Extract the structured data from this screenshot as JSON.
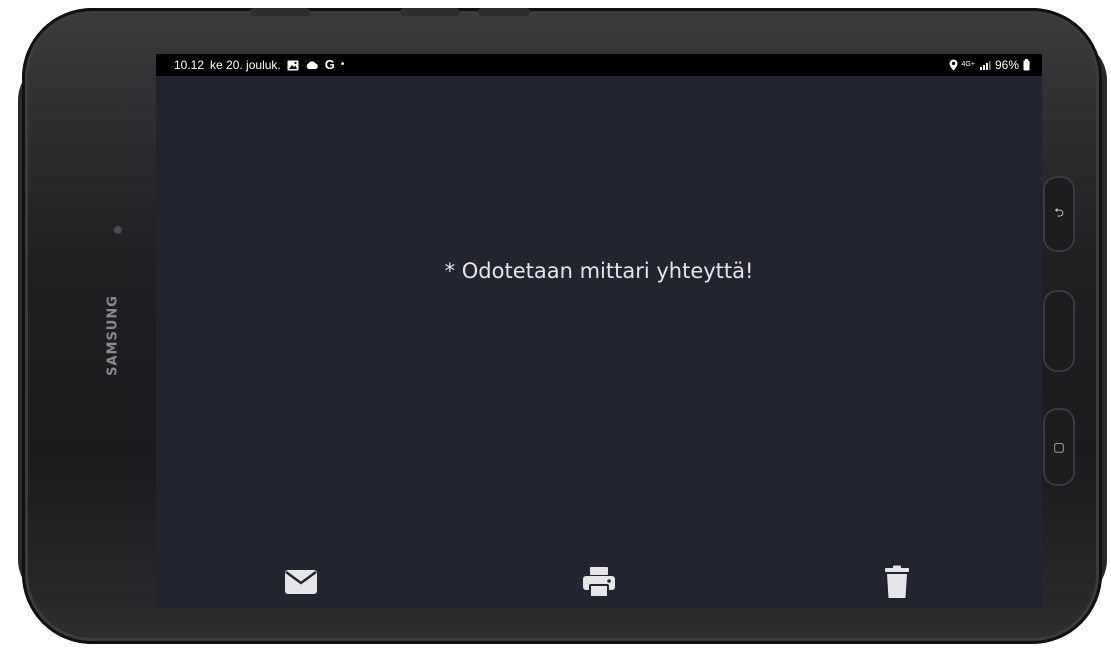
{
  "device": {
    "brand": "SAMSUNG",
    "hw_keys": [
      {
        "name": "back-key",
        "glyph": "⮌"
      },
      {
        "name": "home-key",
        "glyph": ""
      },
      {
        "name": "recents-key",
        "glyph": "▢"
      }
    ]
  },
  "status_bar": {
    "time": "10.12",
    "date": "ke 20. jouluk.",
    "left_icons": [
      "gallery-icon",
      "cloud-icon",
      "google-icon",
      "dot-icon"
    ],
    "google_glyph": "G",
    "dot_glyph": "•",
    "network_label": "4G+",
    "battery_percent": "96%",
    "right_icons": [
      "location-icon",
      "network-icon",
      "signal-icon",
      "battery-icon"
    ]
  },
  "main": {
    "message": "* Odotetaan mittari yhteyttä!"
  },
  "bottom_actions": [
    {
      "name": "email-button",
      "icon": "envelope-icon"
    },
    {
      "name": "print-button",
      "icon": "printer-icon"
    },
    {
      "name": "delete-button",
      "icon": "trash-icon"
    }
  ],
  "colors": {
    "screen_bg": "#22242f",
    "status_bar_bg": "#000000",
    "icon_color": "#e6e6e8",
    "text_color": "#e6e6e8"
  }
}
